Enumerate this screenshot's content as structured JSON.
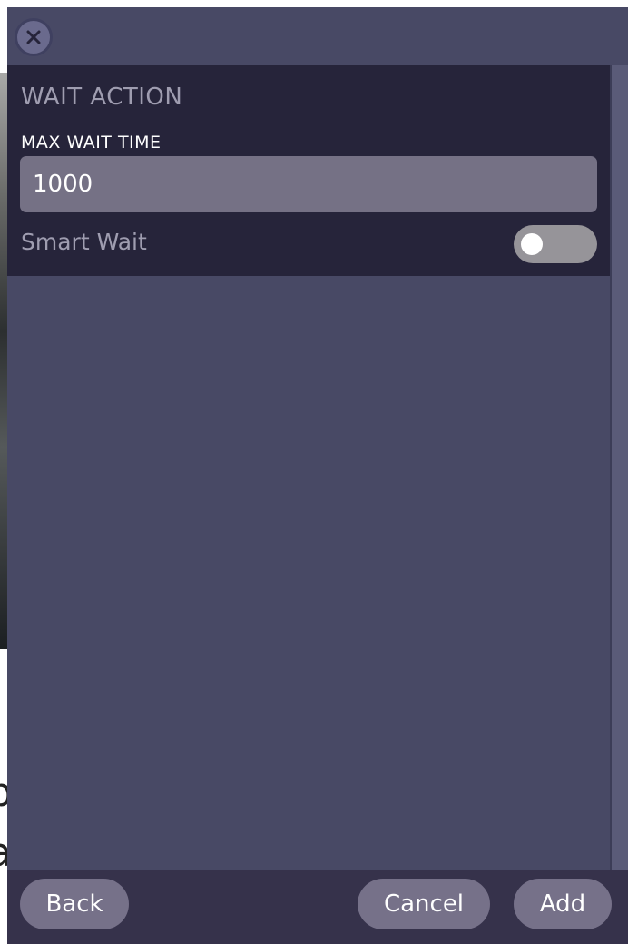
{
  "background": {
    "glyph_1": "p",
    "glyph_2": "a"
  },
  "dialog": {
    "close_icon": "close-icon",
    "section_title": "WAIT ACTION",
    "max_wait": {
      "label": "MAX WAIT TIME",
      "value": "1000"
    },
    "smart_wait": {
      "label": "Smart Wait",
      "enabled": false
    }
  },
  "footer": {
    "back_label": "Back",
    "cancel_label": "Cancel",
    "add_label": "Add"
  },
  "colors": {
    "modal_bg": "#484965",
    "section_bg": "#26243a",
    "input_bg": "#757185",
    "button_bg": "#767189",
    "footer_bg": "#36324b"
  }
}
